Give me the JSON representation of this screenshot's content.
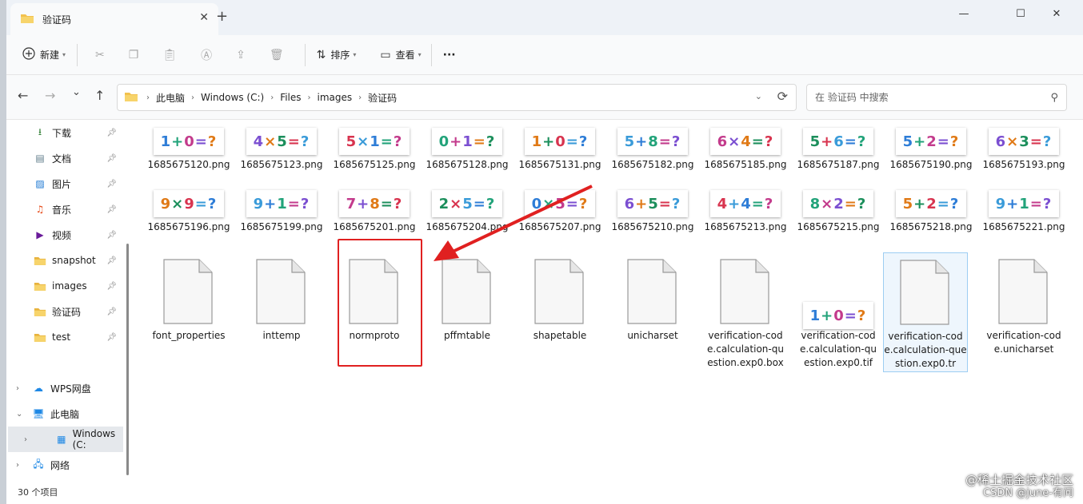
{
  "window": {
    "tab_title": "验证码",
    "new_tab": "+",
    "close_tab": "✕",
    "minimize": "—",
    "maximize": "☐",
    "close": "✕"
  },
  "toolbar": {
    "new_label": "新建",
    "sort_label": "排序",
    "view_label": "查看",
    "more_label": "···"
  },
  "nav": {
    "back": "←",
    "forward": "→",
    "recent": "⌄",
    "up": "↑"
  },
  "address": {
    "breadcrumbs": [
      "此电脑",
      "Windows (C:)",
      "Files",
      "images",
      "验证码"
    ],
    "refresh": "⟳"
  },
  "search": {
    "placeholder": "在 验证码 中搜索"
  },
  "sidebar": {
    "quick": [
      {
        "label": "下载",
        "icon": "download-icon",
        "color": "#2e7d32"
      },
      {
        "label": "文档",
        "icon": "document-icon",
        "color": "#607d8b"
      },
      {
        "label": "图片",
        "icon": "picture-icon",
        "color": "#1976d2"
      },
      {
        "label": "音乐",
        "icon": "music-icon",
        "color": "#e64a19"
      },
      {
        "label": "视频",
        "icon": "video-icon",
        "color": "#6a1b9a"
      },
      {
        "label": "snapshot",
        "icon": "folder-icon",
        "color": "#f2c14e"
      },
      {
        "label": "images",
        "icon": "folder-icon",
        "color": "#f2c14e"
      },
      {
        "label": "验证码",
        "icon": "folder-icon",
        "color": "#f2c14e"
      },
      {
        "label": "test",
        "icon": "folder-icon",
        "color": "#f2c14e"
      }
    ],
    "tree": [
      {
        "label": "WPS网盘",
        "icon": "cloud-icon"
      },
      {
        "label": "此电脑",
        "icon": "computer-icon"
      },
      {
        "label": "Windows  (C:",
        "icon": "drive-icon"
      },
      {
        "label": "网络",
        "icon": "network-icon"
      }
    ]
  },
  "files_row1": [
    {
      "name": "1685675120.png",
      "captcha": "1+0=?"
    },
    {
      "name": "1685675123.png",
      "captcha": "4×5=?"
    },
    {
      "name": "1685675125.png",
      "captcha": "5×1=?"
    },
    {
      "name": "1685675128.png",
      "captcha": "0+1=?"
    },
    {
      "name": "1685675131.png",
      "captcha": "1+0=?"
    },
    {
      "name": "1685675182.png",
      "captcha": "5+8=?"
    },
    {
      "name": "1685675185.png",
      "captcha": "6×4=?"
    },
    {
      "name": "1685675187.png",
      "captcha": "5+6=?"
    },
    {
      "name": "1685675190.png",
      "captcha": "5+2=?"
    },
    {
      "name": "1685675193.png",
      "captcha": "6×3=?"
    }
  ],
  "files_row2": [
    {
      "name": "1685675196.png",
      "captcha": "9×9=?"
    },
    {
      "name": "1685675199.png",
      "captcha": "9+1=?"
    },
    {
      "name": "1685675201.png",
      "captcha": "7+8=?"
    },
    {
      "name": "1685675204.png",
      "captcha": "2×5=?"
    },
    {
      "name": "1685675207.png",
      "captcha": "0×5=?"
    },
    {
      "name": "1685675210.png",
      "captcha": "6+5=?"
    },
    {
      "name": "1685675213.png",
      "captcha": "4+4=?"
    },
    {
      "name": "1685675215.png",
      "captcha": "8×2=?"
    },
    {
      "name": "1685675218.png",
      "captcha": "5+2=?"
    },
    {
      "name": "1685675221.png",
      "captcha": "9+1=?"
    }
  ],
  "files_row3": [
    {
      "name": "font_properties",
      "kind": "doc"
    },
    {
      "name": "inttemp",
      "kind": "doc"
    },
    {
      "name": "normproto",
      "kind": "doc"
    },
    {
      "name": "pffmtable",
      "kind": "doc"
    },
    {
      "name": "shapetable",
      "kind": "doc"
    },
    {
      "name": "unicharset",
      "kind": "doc"
    },
    {
      "name": "verification-code.calculation-question.exp0.box",
      "kind": "doc"
    },
    {
      "name": "verification-code.calculation-question.exp0.tif",
      "kind": "image",
      "captcha": "1+0=?"
    },
    {
      "name": "verification-code.calculation-question.exp0.tr",
      "kind": "doc",
      "selected": true
    },
    {
      "name": "verification-code.unicharset",
      "kind": "doc"
    }
  ],
  "status": {
    "count": "30 个项目"
  },
  "watermark": {
    "line1": "@稀土掘金技术社区",
    "line2": "CSDN @june-有问"
  },
  "colors": {
    "accent": "#0067c0",
    "highlight_box": "#e02020",
    "arrow": "#e02020"
  }
}
